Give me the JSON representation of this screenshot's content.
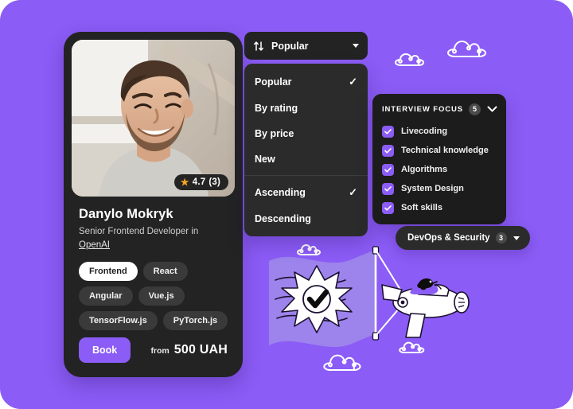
{
  "theme": {
    "background_purple": "#8B5CF6",
    "flag_purple": "#9D83EC",
    "card_dark": "#232323",
    "panel_dark": "#1C1C1C",
    "accent": "#8B5CF6",
    "star_gold": "#F5A623"
  },
  "profile_card": {
    "rating": {
      "icon": "star-icon",
      "value": "4.7",
      "reviews": "(3)"
    },
    "name": "Danylo Mokryk",
    "role_prefix": "Senior Frontend Developer in",
    "company": "OpenAI",
    "tags": [
      {
        "label": "Frontend",
        "active": true
      },
      {
        "label": "React",
        "active": false
      },
      {
        "label": "Angular",
        "active": false
      },
      {
        "label": "Vue.js",
        "active": false
      },
      {
        "label": "TensorFlow.js",
        "active": false
      },
      {
        "label": "PyTorch.js",
        "active": false
      }
    ],
    "book_label": "Book",
    "price_from_label": "from",
    "price_amount": "500 UAH"
  },
  "sort": {
    "icon": "sort-arrows-icon",
    "selected_label": "Popular",
    "chevron": "chevron-down-icon",
    "menu": {
      "group_one": [
        {
          "label": "Popular",
          "checked": true
        },
        {
          "label": "By rating",
          "checked": false
        },
        {
          "label": "By price",
          "checked": false
        },
        {
          "label": "New",
          "checked": false
        }
      ],
      "group_two": [
        {
          "label": "Ascending",
          "checked": true
        },
        {
          "label": "Descending",
          "checked": false
        }
      ],
      "check_glyph": "✓"
    }
  },
  "interview_focus": {
    "title": "INTERVIEW FOCUS",
    "count": "5",
    "chevron": "chevron-down-icon",
    "options": [
      {
        "label": "Livecoding",
        "checked": true
      },
      {
        "label": "Technical knowledge",
        "checked": true
      },
      {
        "label": "Algorithms",
        "checked": true
      },
      {
        "label": "System Design",
        "checked": true
      },
      {
        "label": "Soft skills",
        "checked": true
      }
    ]
  },
  "devops_pill": {
    "label": "DevOps & Security",
    "count": "3",
    "chevron": "chevron-down-icon"
  },
  "illustration": {
    "name": "flag-and-plane-illustration",
    "elements": [
      "waving-flag",
      "starburst-check-badge",
      "airplane",
      "pilot-bird",
      "clouds"
    ]
  }
}
